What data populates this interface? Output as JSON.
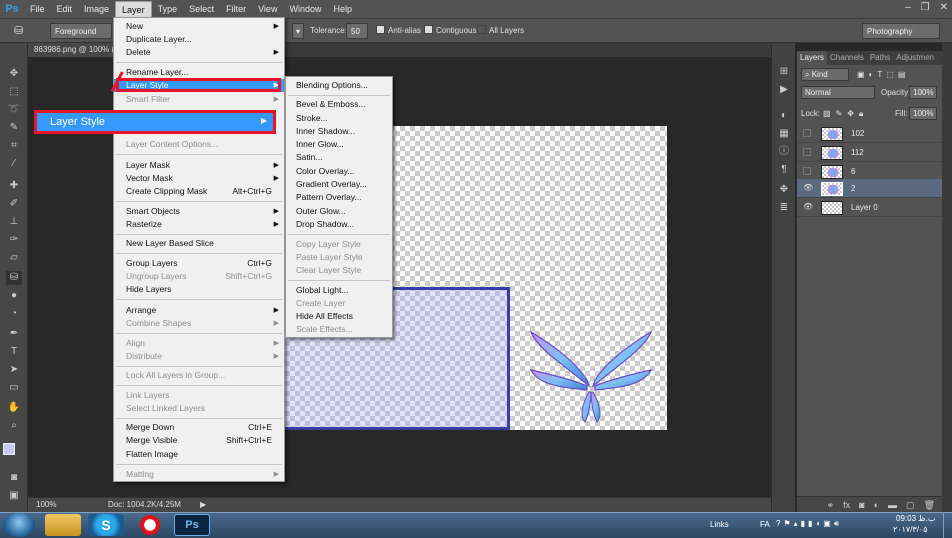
{
  "app": {
    "logo": "Ps"
  },
  "menubar": {
    "items": [
      "File",
      "Edit",
      "Image",
      "Layer",
      "Type",
      "Select",
      "Filter",
      "View",
      "Window",
      "Help"
    ],
    "active": "Layer"
  },
  "options_bar": {
    "fill_source": "Foreground",
    "tolerance_label": "Tolerance:",
    "tolerance_value": "50",
    "anti_alias_label": "Anti-alias",
    "contiguous_label": "Contiguous",
    "all_layers_label": "All Layers",
    "workspace": "Photography"
  },
  "document": {
    "tab_title": "863986.png @ 100% (",
    "zoom": "100%",
    "doc_info": "Doc: 1004.2K/4.25M"
  },
  "layer_menu": {
    "items": [
      {
        "label": "New",
        "arrow": true
      },
      {
        "label": "Duplicate Layer..."
      },
      {
        "label": "Delete",
        "arrow": true
      },
      {
        "label": "Rename Layer..."
      },
      {
        "label": "Layer Style",
        "arrow": true,
        "highlight": true
      },
      {
        "label": "Smart Filter",
        "arrow": true,
        "disabled": true
      },
      {
        "label": "Layer Content Options...",
        "disabled": true
      },
      {
        "label": "Layer Mask",
        "arrow": true
      },
      {
        "label": "Vector Mask",
        "arrow": true
      },
      {
        "label": "Create Clipping Mask",
        "shortcut": "Alt+Ctrl+G"
      },
      {
        "label": "Smart Objects",
        "arrow": true
      },
      {
        "label": "Rasterize",
        "arrow": true
      },
      {
        "label": "New Layer Based Slice"
      },
      {
        "label": "Group Layers",
        "shortcut": "Ctrl+G"
      },
      {
        "label": "Ungroup Layers",
        "shortcut": "Shift+Ctrl+G",
        "disabled": true
      },
      {
        "label": "Hide Layers"
      },
      {
        "label": "Arrange",
        "arrow": true
      },
      {
        "label": "Combine Shapes",
        "arrow": true,
        "disabled": true
      },
      {
        "label": "Align",
        "arrow": true,
        "disabled": true
      },
      {
        "label": "Distribute",
        "arrow": true,
        "disabled": true
      },
      {
        "label": "Lock All Layers in Group...",
        "disabled": true
      },
      {
        "label": "Link Layers",
        "disabled": true
      },
      {
        "label": "Select Linked Layers",
        "disabled": true
      },
      {
        "label": "Merge Down",
        "shortcut": "Ctrl+E"
      },
      {
        "label": "Merge Visible",
        "shortcut": "Shift+Ctrl+E"
      },
      {
        "label": "Flatten Image"
      },
      {
        "label": "Matting",
        "arrow": true,
        "disabled": true
      }
    ]
  },
  "layer_style_submenu": {
    "items": [
      {
        "label": "Blending Options..."
      },
      {
        "label": "Bevel & Emboss..."
      },
      {
        "label": "Stroke..."
      },
      {
        "label": "Inner Shadow..."
      },
      {
        "label": "Inner Glow..."
      },
      {
        "label": "Satin..."
      },
      {
        "label": "Color Overlay..."
      },
      {
        "label": "Gradient Overlay..."
      },
      {
        "label": "Pattern Overlay..."
      },
      {
        "label": "Outer Glow..."
      },
      {
        "label": "Drop Shadow..."
      },
      {
        "label": "Copy Layer Style",
        "disabled": true
      },
      {
        "label": "Paste Layer Style",
        "disabled": true
      },
      {
        "label": "Clear Layer Style",
        "disabled": true
      },
      {
        "label": "Global Light..."
      },
      {
        "label": "Create Layer",
        "disabled": true
      },
      {
        "label": "Hide All Effects"
      },
      {
        "label": "Scale Effects...",
        "disabled": true
      }
    ]
  },
  "annotation": {
    "label": "Layer Style",
    "color": "#e8142a"
  },
  "layers_panel": {
    "tabs": [
      "Layers",
      "Channels",
      "Paths",
      "Adjustmen"
    ],
    "kind_label": "Kind",
    "blend_mode": "Normal",
    "opacity_label": "Opacity:",
    "opacity_value": "100%",
    "lock_label": "Lock:",
    "fill_label": "Fill:",
    "fill_value": "100%",
    "layers": [
      {
        "name": "102",
        "visible": false
      },
      {
        "name": "112",
        "visible": false
      },
      {
        "name": "6",
        "visible": false
      },
      {
        "name": "2",
        "visible": true,
        "selected": true
      },
      {
        "name": "Layer 0",
        "visible": true
      }
    ]
  },
  "taskbar": {
    "links_label": "Links",
    "lang": "FA",
    "time": "09:03 ب.ظ",
    "date": "۲۰۱۷/۳/۰۵"
  },
  "colors": {
    "accent": "#3399ff",
    "selection_border": "#3440a8"
  }
}
